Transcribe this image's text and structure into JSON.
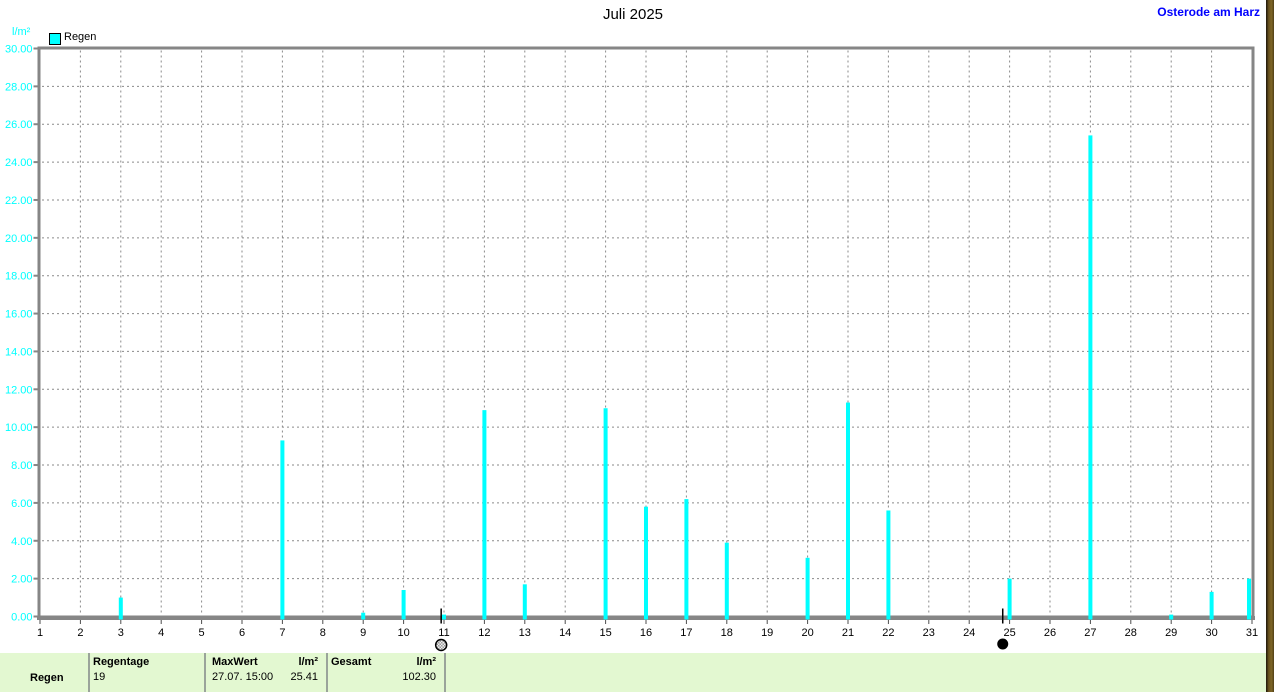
{
  "header": {
    "title": "Juli 2025",
    "station": "Osterode am Harz"
  },
  "chart_data": {
    "type": "bar",
    "title": "Juli 2025",
    "xlabel": "",
    "ylabel": "l/m²",
    "xlim": [
      1,
      31
    ],
    "ylim": [
      0,
      30
    ],
    "y_step": 2,
    "grid": "dashed, vertical per day and horizontal per 2.00",
    "legend_position": "top-left",
    "series": [
      {
        "name": "Regen",
        "color": "#00ffff",
        "points": [
          {
            "day": 3,
            "value": 1.0
          },
          {
            "day": 7,
            "value": 9.3
          },
          {
            "day": 9,
            "value": 0.2
          },
          {
            "day": 10,
            "value": 1.4
          },
          {
            "day": 11,
            "value": 0.1
          },
          {
            "day": 12,
            "value": 10.9
          },
          {
            "day": 13,
            "value": 1.7
          },
          {
            "day": 15,
            "value": 11.0
          },
          {
            "day": 16,
            "value": 5.8
          },
          {
            "day": 17,
            "value": 6.2
          },
          {
            "day": 18,
            "value": 3.9
          },
          {
            "day": 20,
            "value": 3.1
          },
          {
            "day": 21,
            "value": 11.3
          },
          {
            "day": 22,
            "value": 5.6
          },
          {
            "day": 25,
            "value": 2.0
          },
          {
            "day": 27,
            "value": 25.41
          },
          {
            "day": 29,
            "value": 0.1
          },
          {
            "day": 30,
            "value": 1.3
          },
          {
            "day": 31,
            "value": 2.0
          }
        ]
      }
    ],
    "x_tick_labels": [
      "1",
      "2",
      "3",
      "4",
      "5",
      "6",
      "7",
      "8",
      "9",
      "10",
      "11",
      "12",
      "13",
      "14",
      "15",
      "16",
      "17",
      "18",
      "19",
      "20",
      "21",
      "22",
      "23",
      "24",
      "25",
      "26",
      "27",
      "28",
      "29",
      "30",
      "31"
    ],
    "y_tick_labels": [
      "30.00",
      "28.00",
      "26.00",
      "24.00",
      "22.00",
      "20.00",
      "18.00",
      "16.00",
      "14.00",
      "12.00",
      "10.00",
      "8.00",
      "6.00",
      "4.00",
      "2.00",
      "0.00"
    ],
    "moon_markers": [
      {
        "day": 10.93,
        "symbol": "open-circle"
      },
      {
        "day": 24.83,
        "symbol": "filled-circle"
      }
    ]
  },
  "summary_table": {
    "row_label": "Regen",
    "regentage": {
      "header": "Regentage",
      "value": "19"
    },
    "maxwert": {
      "header": "MaxWert",
      "unit": "l/m²",
      "datetime": "27.07.  15:00",
      "value": "25.41"
    },
    "gesamt": {
      "header": "Gesamt",
      "unit": "l/m²",
      "value": "102.30"
    }
  },
  "colors": {
    "bar": "#00ffff",
    "y_axis_text": "#00ffff",
    "x_axis_text": "#000000",
    "grid": "#8a8a8a",
    "axis_frame": "#868686",
    "station_link": "#0000ff",
    "summary_background": "#e3f8d1",
    "moon_marker": "#000000"
  }
}
